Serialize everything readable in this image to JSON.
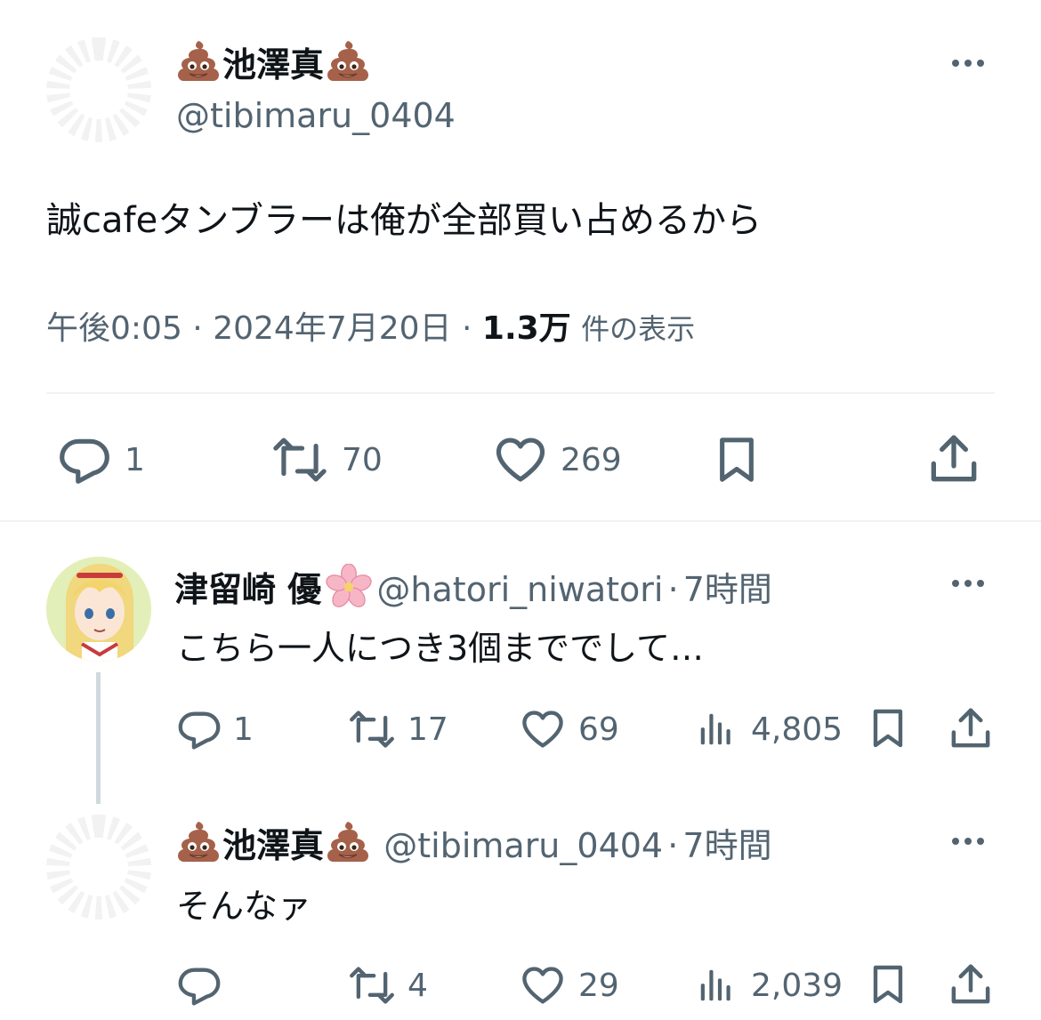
{
  "main_tweet": {
    "display_name": "池澤真",
    "handle": "@tibimaru_0404",
    "text": "誠cafeタンブラーは俺が全部買い占めるから",
    "time": "午後0:05",
    "sep1": "·",
    "date": "2024年7月20日",
    "sep2": "·",
    "views_count": "1.3万",
    "views_label": "件の表示",
    "replies": "1",
    "retweets": "70",
    "likes": "269"
  },
  "replies": [
    {
      "display_name": "津留崎 優",
      "handle": "@hatori_niwatori",
      "time_sep": "·",
      "time": "7時間",
      "text": "こちら一人につき3個まででして…",
      "replies": "1",
      "retweets": "17",
      "likes": "69",
      "views": "4,805"
    },
    {
      "display_name": "池澤真",
      "handle": "@tibimaru_0404",
      "time_sep": "·",
      "time": "7時間",
      "text": "そんなァ",
      "replies": "",
      "retweets": "4",
      "likes": "29",
      "views": "2,039"
    }
  ],
  "icons": {
    "more": "more-dots-icon",
    "reply": "reply-bubble-icon",
    "retweet": "retweet-icon",
    "like": "heart-icon",
    "views": "views-bar-icon",
    "bookmark": "bookmark-icon",
    "share": "share-icon",
    "emoji_name": "poo-emoji-icon",
    "emoji_flower": "cherry-blossom-icon"
  },
  "colors": {
    "text": "#0f1419",
    "secondary": "#536471",
    "divider": "#eff3f4",
    "thread_line": "#cfd9de"
  }
}
